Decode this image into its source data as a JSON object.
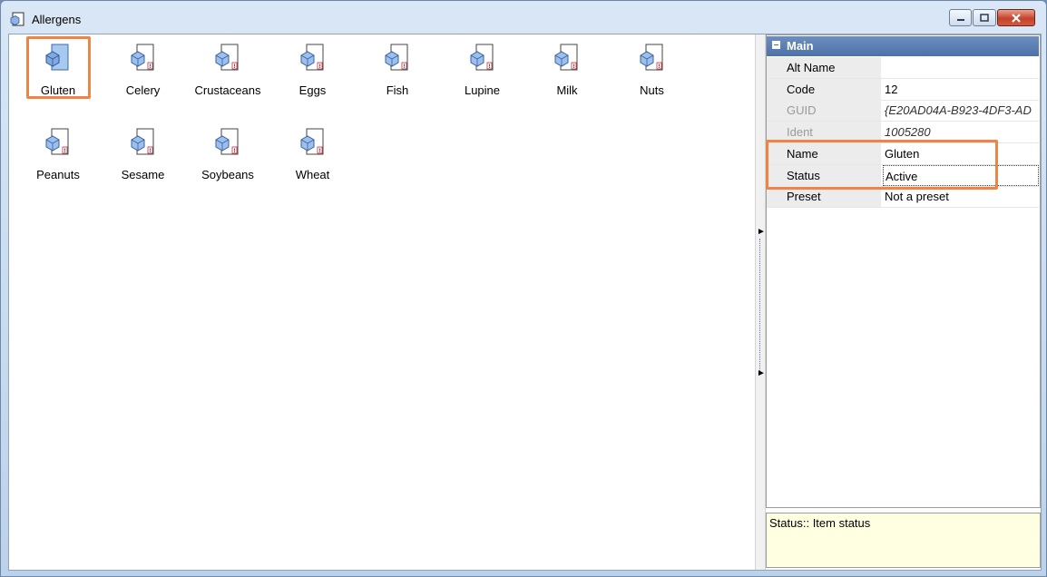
{
  "window": {
    "title": "Allergens"
  },
  "allergens": [
    {
      "label": "Gluten",
      "selected": true
    },
    {
      "label": "Celery"
    },
    {
      "label": "Crustaceans"
    },
    {
      "label": "Eggs"
    },
    {
      "label": "Fish"
    },
    {
      "label": "Lupine"
    },
    {
      "label": "Milk"
    },
    {
      "label": "Nuts"
    },
    {
      "label": "Peanuts"
    },
    {
      "label": "Sesame"
    },
    {
      "label": "Soybeans"
    },
    {
      "label": "Wheat"
    }
  ],
  "properties": {
    "category": "Main",
    "rows": [
      {
        "name": "Alt Name",
        "value": ""
      },
      {
        "name": "Code",
        "value": "12"
      },
      {
        "name": "GUID",
        "value": "{E20AD04A-B923-4DF3-AD",
        "readonly": true
      },
      {
        "name": "Ident",
        "value": "1005280",
        "readonly": true
      },
      {
        "name": "Name",
        "value": "Gluten"
      },
      {
        "name": "Status",
        "value": "Active"
      },
      {
        "name": "Preset",
        "value": "Not a preset"
      }
    ]
  },
  "description": "Status:: Item status",
  "colors": {
    "highlight": "#f08444",
    "category_header": "#4c71a8",
    "description_bg": "#ffffe1"
  },
  "icons": {
    "item": "allergen-document-icon",
    "close": "close-icon",
    "minimize": "minimize-icon",
    "maximize": "maximize-icon"
  }
}
